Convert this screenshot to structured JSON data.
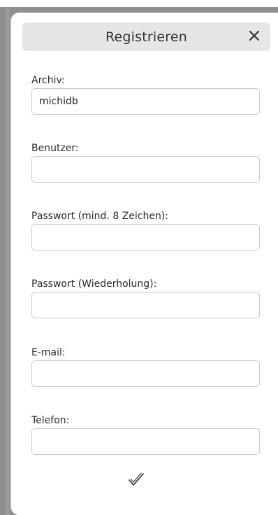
{
  "dialog": {
    "title": "Registrieren",
    "close_icon": "close-icon"
  },
  "fields": {
    "archiv": {
      "label": "Archiv:",
      "value": "michidb"
    },
    "benutzer": {
      "label": "Benutzer:",
      "value": ""
    },
    "passwort": {
      "label": "Passwort (mind. 8 Zeichen):",
      "value": ""
    },
    "passwort_wdh": {
      "label": "Passwort (Wiederholung):",
      "value": ""
    },
    "email": {
      "label": "E-mail:",
      "value": ""
    },
    "telefon": {
      "label": "Telefon:",
      "value": ""
    }
  },
  "confirm": {
    "icon": "checkmark-icon"
  },
  "colors": {
    "background": "#8f8f8f",
    "titlebar": "#e6e6e6",
    "border": "#c9c9c9"
  }
}
